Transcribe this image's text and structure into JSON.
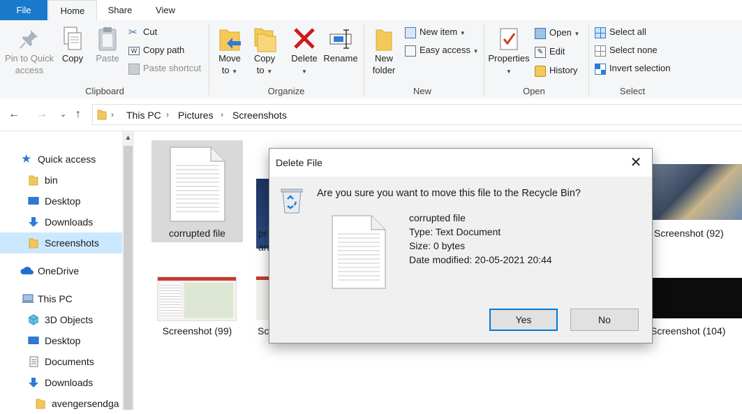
{
  "tabs": {
    "file": "File",
    "home": "Home",
    "share": "Share",
    "view": "View"
  },
  "ribbon": {
    "clipboard": {
      "pin": "Pin to Quick access",
      "pin_line1": "Pin to Quick",
      "pin_line2": "access",
      "copy": "Copy",
      "paste": "Paste",
      "cut": "Cut",
      "copy_path": "Copy path",
      "paste_shortcut": "Paste shortcut",
      "group": "Clipboard"
    },
    "organize": {
      "move_to_1": "Move",
      "move_to_2": "to",
      "copy_to_1": "Copy",
      "copy_to_2": "to",
      "delete": "Delete",
      "rename": "Rename",
      "group": "Organize"
    },
    "new": {
      "new_folder_1": "New",
      "new_folder_2": "folder",
      "new_item": "New item",
      "easy_access": "Easy access",
      "group": "New"
    },
    "open": {
      "properties": "Properties",
      "open": "Open",
      "edit": "Edit",
      "history": "History",
      "group": "Open"
    },
    "select": {
      "select_all": "Select all",
      "select_none": "Select none",
      "invert": "Invert selection",
      "group": "Select"
    }
  },
  "address": {
    "crumbs": [
      "This PC",
      "Pictures",
      "Screenshots"
    ]
  },
  "sidebar": {
    "items": [
      {
        "label": "Quick access",
        "icon": "star-icon"
      },
      {
        "label": "bin",
        "icon": "folder-icon"
      },
      {
        "label": "Desktop",
        "icon": "desktop-icon"
      },
      {
        "label": "Downloads",
        "icon": "download-icon"
      },
      {
        "label": "Screenshots",
        "icon": "folder-icon"
      },
      {
        "label": "OneDrive",
        "icon": "cloud-icon"
      },
      {
        "label": "This PC",
        "icon": "computer-icon"
      },
      {
        "label": "3D Objects",
        "icon": "cube-icon"
      },
      {
        "label": "Desktop",
        "icon": "desktop-icon"
      },
      {
        "label": "Documents",
        "icon": "document-icon"
      },
      {
        "label": "Downloads",
        "icon": "download-icon"
      },
      {
        "label": "avengersendga",
        "icon": "folder-icon"
      }
    ]
  },
  "files": [
    {
      "name": "corrupted file"
    },
    {
      "name": "pr"
    },
    {
      "name": "an"
    },
    {
      "name": "Screenshot (92)"
    },
    {
      "name": "Screenshot (99)"
    },
    {
      "name": "Sc"
    },
    {
      "name": "Screenshot (104)"
    }
  ],
  "dialog": {
    "title": "Delete File",
    "question": "Are you sure you want to move this file to the Recycle Bin?",
    "file_name": "corrupted file",
    "type": "Type: Text Document",
    "size": "Size: 0 bytes",
    "modified": "Date modified: 20-05-2021 20:44",
    "yes": "Yes",
    "no": "No"
  },
  "colors": {
    "accent": "#1979ca",
    "selection": "#cce8ff",
    "delete_red": "#d0181b",
    "folder": "#f0c75e"
  }
}
